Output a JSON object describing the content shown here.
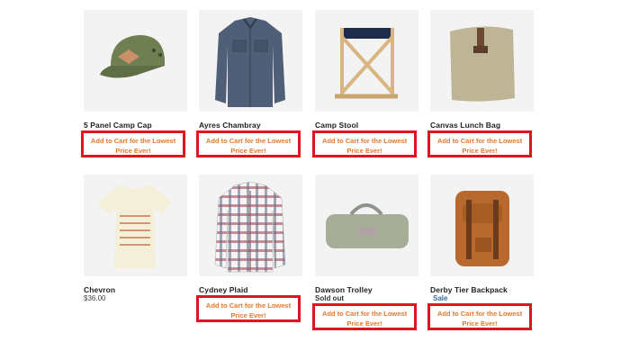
{
  "products": [
    {
      "name": "5 Panel Camp Cap",
      "sub": "",
      "cta": "Add to Cart for the Lowest Price Ever!",
      "image": "camp-cap-image"
    },
    {
      "name": "Ayres Chambray",
      "sub": "",
      "cta": "Add to Cart for the Lowest Price Ever!",
      "image": "chambray-shirt-image"
    },
    {
      "name": "Camp Stool",
      "sub": "",
      "cta": "Add to Cart for the Lowest Price Ever!",
      "image": "camp-stool-image"
    },
    {
      "name": "Canvas Lunch Bag",
      "sub": "",
      "cta": "Add to Cart for the Lowest Price Ever!",
      "image": "lunch-bag-image"
    },
    {
      "name": "Chevron",
      "sub": "$36.00",
      "cta": "",
      "image": "chevron-tshirt-image"
    },
    {
      "name": "Cydney Plaid",
      "sub": "",
      "cta": "Add to Cart for the Lowest Price Ever!",
      "image": "plaid-shirt-image"
    },
    {
      "name": "Dawson Trolley",
      "sub": "Sold out",
      "cta": "Add to Cart for the Lowest Price Ever!",
      "image": "duffel-bag-image"
    },
    {
      "name": "Derby Tier Backpack",
      "sub": "Sale",
      "cta": "Add to Cart for the Lowest Price Ever!",
      "image": "backpack-image"
    }
  ],
  "colors": {
    "cta_border": "#e1151f",
    "cta_text": "#e8782a",
    "sale_text": "#3a6b9a"
  }
}
